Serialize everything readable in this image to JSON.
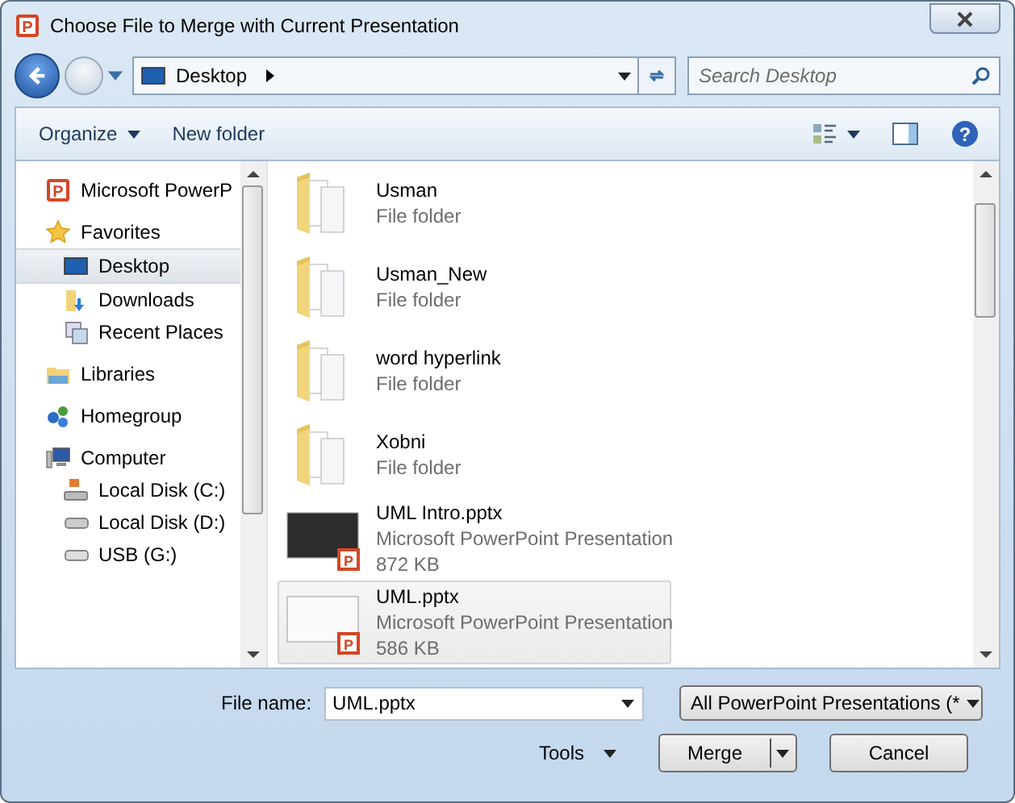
{
  "window": {
    "title": "Choose File to Merge with Current Presentation",
    "icon_letter": "P"
  },
  "address": {
    "location": "Desktop"
  },
  "search": {
    "placeholder": "Search Desktop"
  },
  "toolbar": {
    "organize": "Organize",
    "new_folder": "New folder",
    "help": "?"
  },
  "sidebar": {
    "groups": [
      {
        "label": "Microsoft PowerP",
        "icon_letter": "P",
        "selected": false
      },
      {
        "label": "Favorites",
        "selected": false,
        "children": [
          {
            "label": "Desktop",
            "selected": true
          },
          {
            "label": "Downloads",
            "selected": false
          },
          {
            "label": "Recent Places",
            "selected": false
          }
        ]
      },
      {
        "label": "Libraries",
        "selected": false
      },
      {
        "label": "Homegroup",
        "selected": false
      },
      {
        "label": "Computer",
        "selected": false,
        "children": [
          {
            "label": "Local Disk (C:)",
            "selected": false
          },
          {
            "label": "Local Disk (D:)",
            "selected": false
          },
          {
            "label": "USB (G:)",
            "selected": false
          }
        ]
      }
    ]
  },
  "files": [
    {
      "kind": "folder",
      "name": "Usman",
      "type": "File folder",
      "selected": false
    },
    {
      "kind": "folder",
      "name": "Usman_New",
      "type": "File folder",
      "selected": false
    },
    {
      "kind": "folder",
      "name": "word hyperlink",
      "type": "File folder",
      "selected": false
    },
    {
      "kind": "folder",
      "name": "Xobni",
      "type": "File folder",
      "selected": false
    },
    {
      "kind": "presentation",
      "name": "UML Intro.pptx",
      "type": "Microsoft PowerPoint Presentation",
      "size": "872 KB",
      "badge": "P",
      "selected": false
    },
    {
      "kind": "presentation",
      "name": "UML.pptx",
      "type": "Microsoft PowerPoint Presentation",
      "size": "586 KB",
      "badge": "P",
      "selected": true
    }
  ],
  "footer": {
    "file_name_label": "File name:",
    "file_name": "UML.pptx",
    "filter": "All PowerPoint Presentations (*",
    "tools": "Tools",
    "primary": "Merge",
    "cancel": "Cancel"
  }
}
